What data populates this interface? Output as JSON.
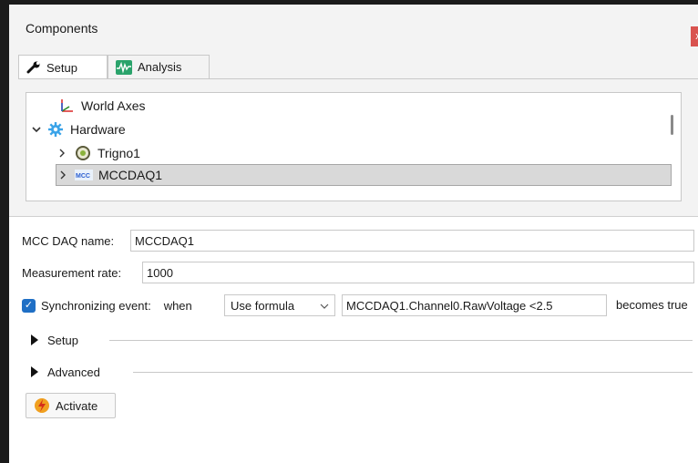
{
  "window": {
    "title": "Components",
    "close_label": "x"
  },
  "tabs": [
    {
      "label": "Setup",
      "icon": "wrench-icon"
    },
    {
      "label": "Analysis",
      "icon": "waveform-icon"
    }
  ],
  "tree": {
    "items": [
      {
        "label": "World Axes",
        "icon": "axes-icon",
        "expander": ""
      },
      {
        "label": "Hardware",
        "icon": "gear-icon",
        "expander": "expanded"
      },
      {
        "label": "Trigno1",
        "icon": "sensor-icon",
        "expander": "collapsed"
      },
      {
        "label": "MCCDAQ1",
        "icon": "mcc-icon",
        "expander": "collapsed",
        "selected": true
      }
    ]
  },
  "props": {
    "name_label": "MCC DAQ name:",
    "name_value": "MCCDAQ1",
    "rate_label": "Measurement rate:",
    "rate_value": "1000",
    "sync_label": "Synchronizing event:",
    "sync_checked": true,
    "when_label": "when",
    "mode_value": "Use formula",
    "formula_value": "MCCDAQ1.Channel0.RawVoltage <2.5",
    "becomes_label": "becomes true",
    "setup_section": "Setup",
    "advanced_section": "Advanced",
    "activate_label": "Activate"
  },
  "colors": {
    "accent": "#1f6fc5",
    "selection": "#d9d9d9",
    "close": "#d9534f"
  }
}
